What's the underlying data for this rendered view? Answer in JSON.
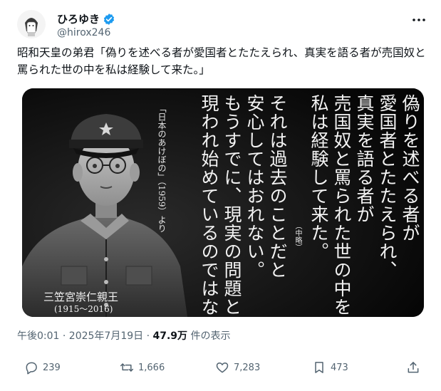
{
  "author": {
    "display_name": "ひろゆき",
    "handle": "@hirox246"
  },
  "tweet": {
    "text": "昭和天皇の弟君「偽りを述べる者が愛国者とたたえられ、真実を語る者が売国奴と罵られた世の中を私は経験して来た。」",
    "timestamp": "午後0:01 · 2025年7月19日 · ",
    "views_count": "47.9万",
    "views_label": " 件の表示"
  },
  "image": {
    "columns": [
      "偽りを述べる者が",
      "愛国者とたたえられ、",
      "真実を語る者が",
      "売国奴と罵られた世の中を",
      "私は経験して来た。",
      "それは過去のことだと",
      "安心してはおれない。",
      "もうすでに、現実の問題として",
      "現われ始めているのではないか。"
    ],
    "abbrev_note": "（中略）",
    "source": "「日本のあけぼの」（1959）より",
    "person_name": "三笠宮崇仁親王",
    "person_years": "(1915～2016)"
  },
  "actions": {
    "replies": "239",
    "reposts": "1,666",
    "likes": "7,283",
    "bookmarks": "473"
  },
  "colors": {
    "verified": "#1d9bf0",
    "muted": "#536471",
    "text": "#0f1419"
  }
}
